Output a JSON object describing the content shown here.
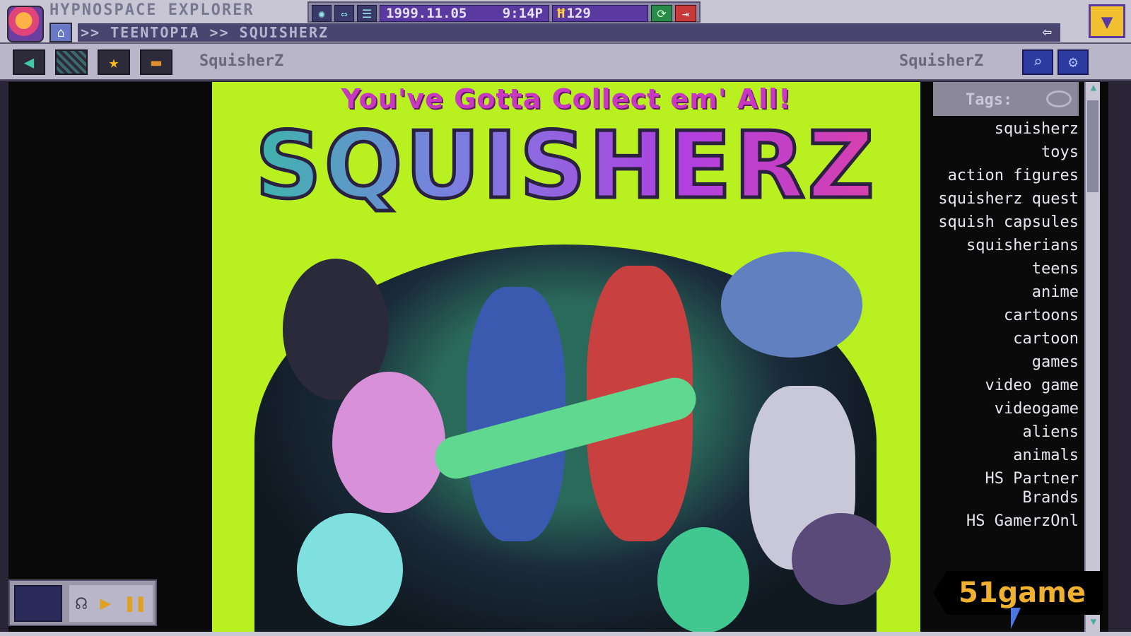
{
  "window": {
    "app_title": "HYPNOSPACE EXPLORER",
    "breadcrumb": ">> TEENTOPIA >> SQUISHERZ",
    "date": "1999.11.05",
    "time": "9:14P",
    "coins": "129",
    "icons": [
      "settings-icon",
      "transfer-icon",
      "list-icon",
      "refresh-icon",
      "exit-icon",
      "minimize-icon"
    ]
  },
  "nav": {
    "page_name_left": "SquisherZ",
    "page_name_right": "SquisherZ"
  },
  "banner": {
    "tagline": "You've Gotta Collect em' All!",
    "logo": "SQUISHERZ"
  },
  "tags": {
    "header": "Tags:",
    "items": [
      "squisherz",
      "toys",
      "action figures",
      "squisherz quest",
      "squish capsules",
      "squisherians",
      "teens",
      "anime",
      "cartoons",
      "cartoon",
      "games",
      "video game",
      "videogame",
      "aliens",
      "animals",
      "HS Partner Brands",
      "HS GamerzOnl"
    ]
  },
  "watermark": "51game"
}
